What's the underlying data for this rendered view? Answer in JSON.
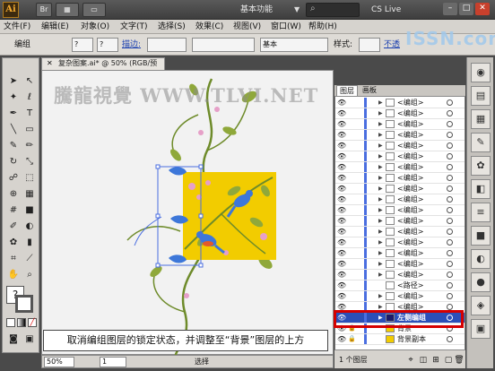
{
  "titlebar": {
    "app_logo": "Ai",
    "workspace": "基本功能",
    "cs_live": "CS Live",
    "buttons": [
      "Br",
      "▦",
      "▭"
    ]
  },
  "menubar": {
    "items": [
      "文件(F)",
      "编辑(E)",
      "对象(O)",
      "文字(T)",
      "选择(S)",
      "效果(C)",
      "视图(V)",
      "窗口(W)",
      "帮助(H)"
    ]
  },
  "controlbar": {
    "selection_label": "编组",
    "fill": "?",
    "stroke": "?",
    "stroke_label": "描边:",
    "style_label": "样式:",
    "brush": "基本",
    "opacity_label": "不透"
  },
  "watermark_top": "ISSN.com",
  "document": {
    "tab_title": "复杂图案.ai* @ 50% (RGB/预览)",
    "canvas_watermark": "騰龍視覺 WWW.TLVI.NET",
    "caption": "取消编组图层的锁定状态，并调整至“背景”图层的上方"
  },
  "statusbar": {
    "zoom": "50%",
    "page": "1",
    "status": "选择"
  },
  "layers_panel": {
    "tabs": [
      "图层",
      "画板"
    ],
    "rows": [
      {
        "name": "<编组>"
      },
      {
        "name": "<编组>"
      },
      {
        "name": "<编组>"
      },
      {
        "name": "<编组>"
      },
      {
        "name": "<编组>"
      },
      {
        "name": "<编组>"
      },
      {
        "name": "<编组>"
      },
      {
        "name": "<编组>"
      },
      {
        "name": "<编组>"
      },
      {
        "name": "<编组>"
      },
      {
        "name": "<编组>"
      },
      {
        "name": "<编组>"
      },
      {
        "name": "<编组>"
      },
      {
        "name": "<编组>"
      },
      {
        "name": "<编组>"
      },
      {
        "name": "<编组>"
      },
      {
        "name": "<编组>"
      },
      {
        "name": "<路径>"
      },
      {
        "name": "<编组>"
      },
      {
        "name": "<编组>"
      },
      {
        "name": "左侧编组",
        "highlighted": true
      },
      {
        "name": "背景"
      },
      {
        "name": "背景副本"
      }
    ],
    "layer_count": "1 个图层"
  },
  "colors": {
    "canvas_yellow": "#f2cc00",
    "bird_blue": "#3d77d9",
    "vine_green": "#6e8b2a",
    "highlight_red": "#d50000",
    "selection_blue": "#4a6ee0"
  }
}
